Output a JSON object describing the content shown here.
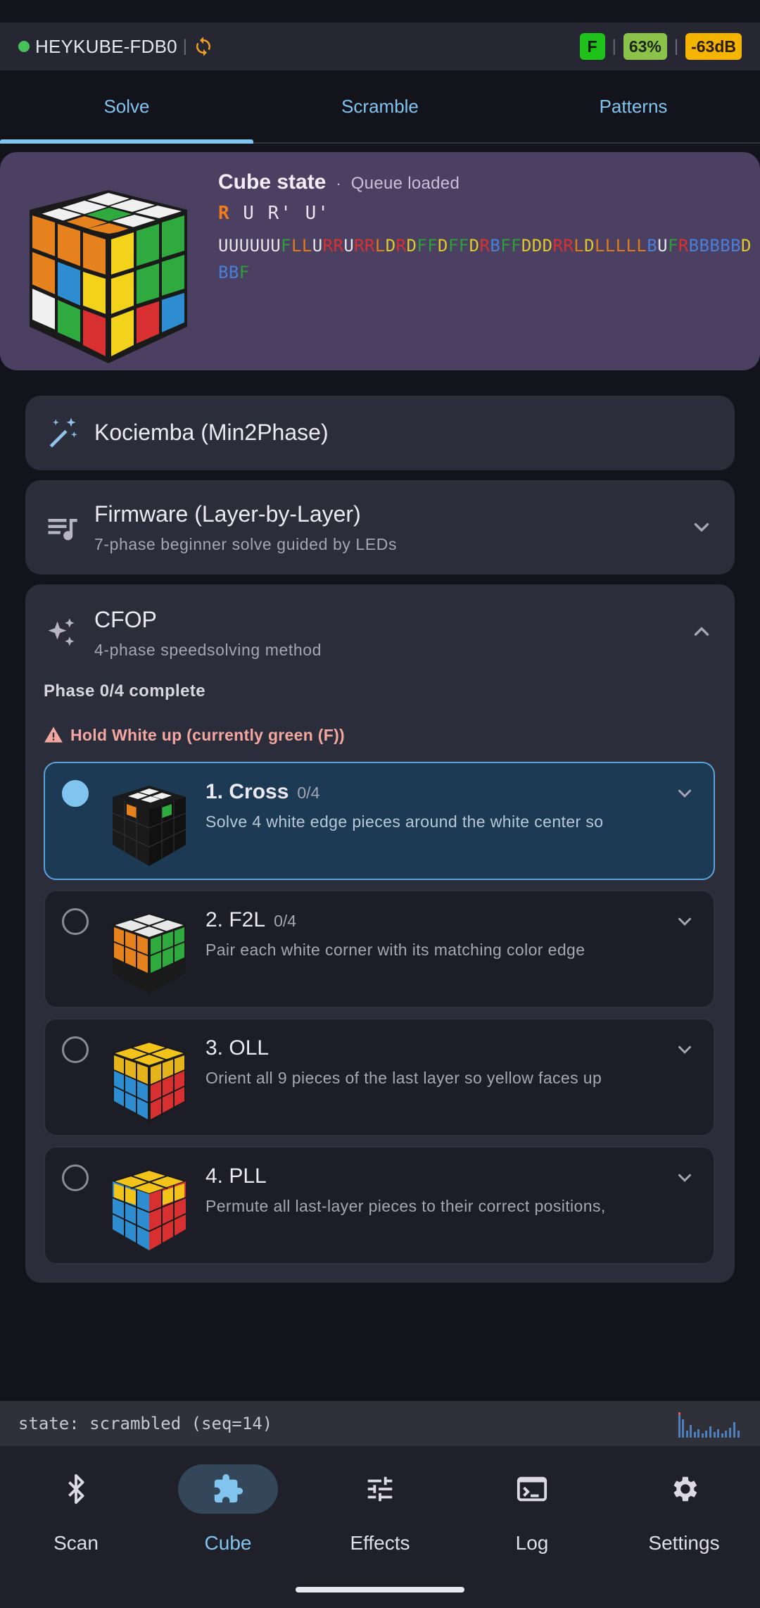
{
  "header": {
    "device_name": "HEYKUBE-FDB0",
    "separator": "|",
    "face_badge": "F",
    "battery": "63%",
    "signal": "-63dB",
    "colors": {
      "connected": "#48c15a",
      "face_badge": "#1fc21a",
      "battery": "#8bc34a",
      "signal": "#f5b400"
    }
  },
  "tabs": [
    {
      "label": "Solve",
      "active": true
    },
    {
      "label": "Scramble",
      "active": false
    },
    {
      "label": "Patterns",
      "active": false
    }
  ],
  "cube_state": {
    "title": "Cube state",
    "dot": "·",
    "queue_status": "Queue loaded",
    "moves_first": "R",
    "moves_rest": " U R' U'",
    "facelets": "UUUUUUFLLURRURRLDRDFFDFFDRBFFDDDRRLDLLLLLBUFRBBBBBDBBF",
    "facelet_colors": {
      "U": "#e6e6e6",
      "F": "#2e9e3a",
      "L": "#e07a14",
      "R": "#d93030",
      "D": "#e0c82a",
      "B": "#4a7fd8"
    }
  },
  "methods": {
    "kociemba": {
      "title": "Kociemba (Min2Phase)",
      "icon": "magic-wand-icon"
    },
    "firmware": {
      "title": "Firmware (Layer-by-Layer)",
      "subtitle": "7-phase beginner solve guided by LEDs",
      "icon": "queue-music-icon"
    },
    "cfop": {
      "title": "CFOP",
      "subtitle": "4-phase speedsolving method",
      "icon": "sparkles-icon",
      "progress": "Phase 0/4 complete",
      "warning": "Hold White up (currently green (F))",
      "phases": [
        {
          "title": "1. Cross",
          "count": "0/4",
          "desc": "Solve 4 white edge pieces around the white center so",
          "active": true
        },
        {
          "title": "2. F2L",
          "count": "0/4",
          "desc": "Pair each white corner with its matching color edge",
          "active": false
        },
        {
          "title": "3. OLL",
          "count": "",
          "desc": "Orient all 9 pieces of the last layer so yellow faces up",
          "active": false
        },
        {
          "title": "4. PLL",
          "count": "",
          "desc": "Permute all last-layer pieces to their correct positions,",
          "active": false
        }
      ]
    }
  },
  "status_strip": {
    "text": "state: scrambled (seq=14)"
  },
  "nav": [
    {
      "label": "Scan",
      "icon": "bluetooth-icon",
      "active": false
    },
    {
      "label": "Cube",
      "icon": "puzzle-piece-icon",
      "active": true
    },
    {
      "label": "Effects",
      "icon": "sliders-icon",
      "active": false
    },
    {
      "label": "Log",
      "icon": "terminal-icon",
      "active": false
    },
    {
      "label": "Settings",
      "icon": "gear-icon",
      "active": false
    }
  ]
}
